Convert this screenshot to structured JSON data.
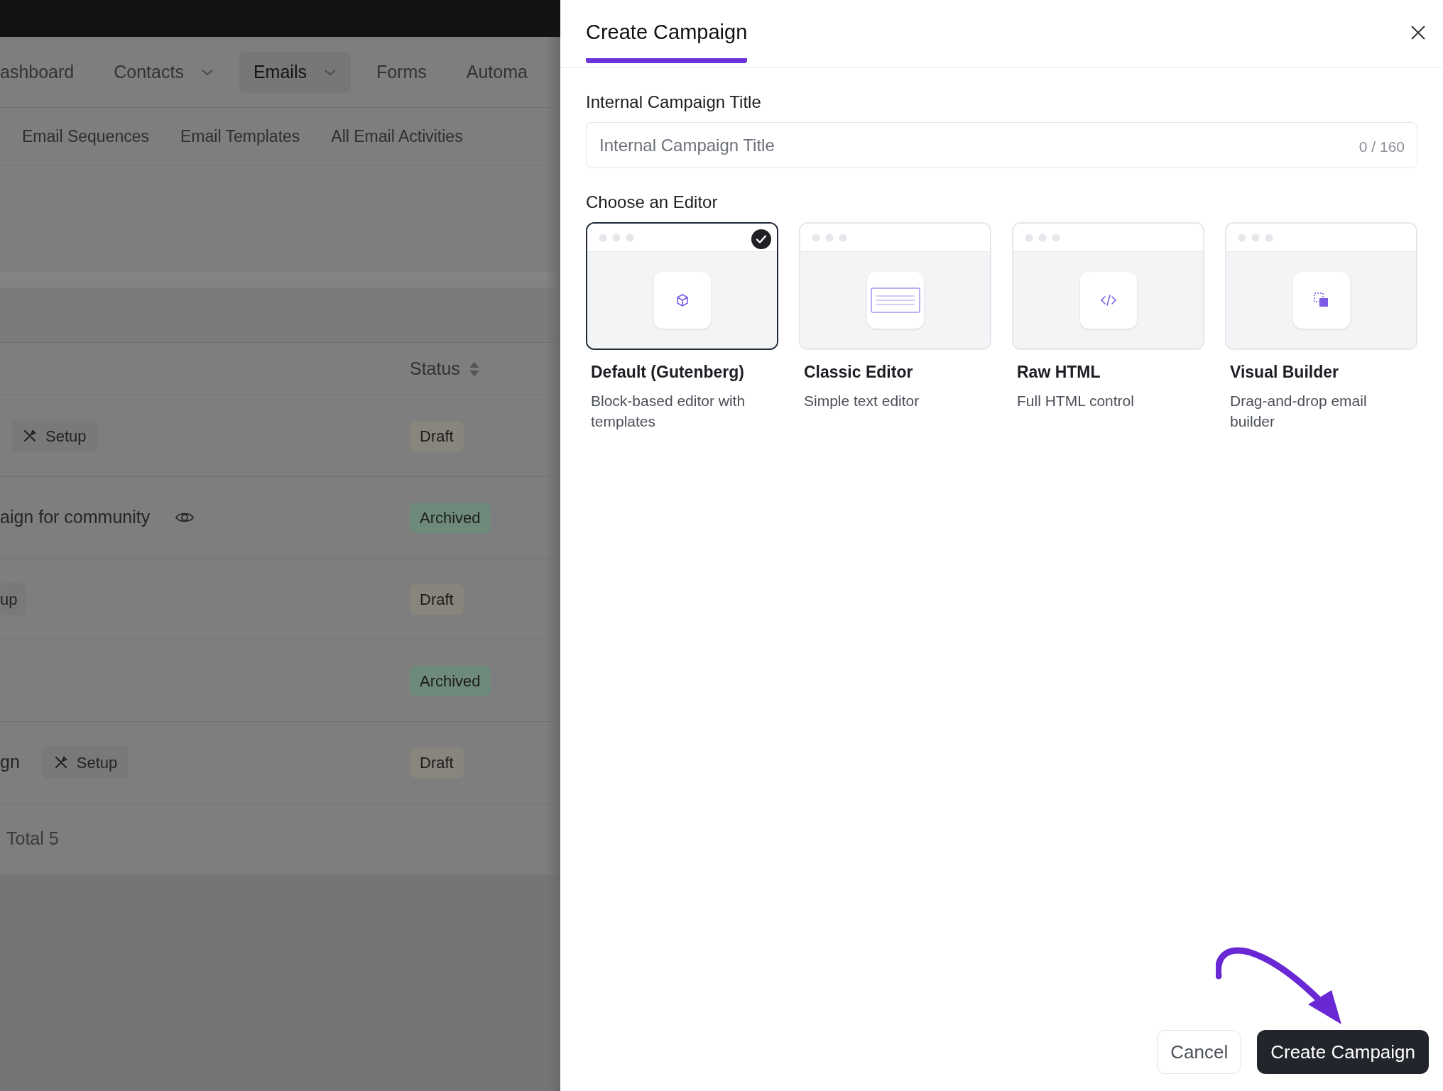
{
  "nav": {
    "items": [
      {
        "label": "ashboard",
        "has_caret": false,
        "selected": false
      },
      {
        "label": "Contacts",
        "has_caret": true,
        "selected": false
      },
      {
        "label": "Emails",
        "has_caret": true,
        "selected": true
      },
      {
        "label": "Forms",
        "has_caret": false,
        "selected": false
      },
      {
        "label": "Automa",
        "has_caret": false,
        "selected": false
      }
    ]
  },
  "subnav": {
    "items": [
      "Email Sequences",
      "Email Templates",
      "All Email Activities"
    ]
  },
  "table": {
    "columns": [
      {
        "label": "Status"
      }
    ],
    "rows": [
      {
        "parts": [
          {
            "kind": "setup_tag",
            "label": "Setup"
          }
        ],
        "status": "Draft",
        "kind": "draft"
      },
      {
        "parts": [
          {
            "kind": "text",
            "label": "aign for community"
          },
          {
            "kind": "eye"
          }
        ],
        "status": "Archived",
        "kind": "archived"
      },
      {
        "parts": [
          {
            "kind": "cut_tag",
            "label": "up"
          }
        ],
        "status": "Draft",
        "kind": "draft"
      },
      {
        "parts": [],
        "status": "Archived",
        "kind": "archived"
      },
      {
        "parts": [
          {
            "kind": "text",
            "label": "gn"
          },
          {
            "kind": "setup_tag",
            "label": "Setup"
          }
        ],
        "status": "Draft",
        "kind": "draft"
      }
    ],
    "footer": "Total 5"
  },
  "drawer": {
    "title": "Create Campaign",
    "field": {
      "label": "Internal Campaign Title",
      "placeholder": "Internal Campaign Title",
      "counter": "0 / 160"
    },
    "editor_label": "Choose an Editor",
    "editors": [
      {
        "name": "Default (Gutenberg)",
        "description": "Block-based editor with templates",
        "selected": true,
        "kind": "blocks"
      },
      {
        "name": "Classic Editor",
        "description": "Simple text editor",
        "selected": false,
        "kind": "classic"
      },
      {
        "name": "Raw HTML",
        "description": "Full HTML control",
        "selected": false,
        "kind": "html"
      },
      {
        "name": "Visual Builder",
        "description": "Drag-and-drop email builder",
        "selected": false,
        "kind": "visual"
      }
    ],
    "buttons": [
      {
        "label": "Cancel",
        "kind": "secondary"
      },
      {
        "label": "Create Campaign",
        "kind": "primary"
      }
    ]
  }
}
